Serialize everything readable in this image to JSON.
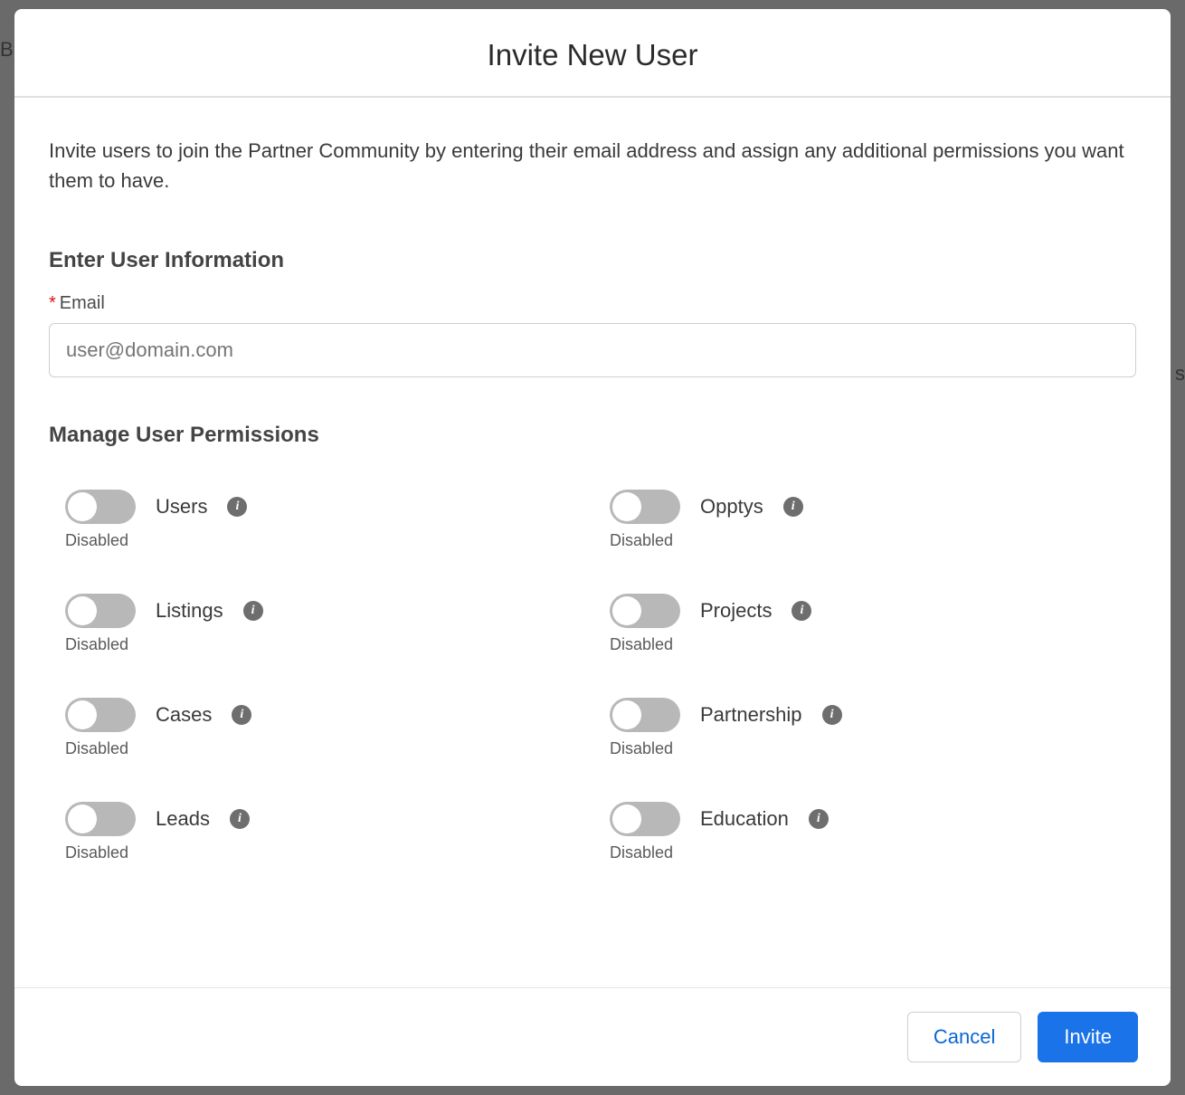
{
  "background": {
    "left_char": "B",
    "right_char": "s"
  },
  "modal": {
    "title": "Invite New User",
    "intro": "Invite users to join the Partner Community by entering their email address and assign any additional permissions you want them to have.",
    "user_info_heading": "Enter User Information",
    "email_label": "Email",
    "email_required": "*",
    "email_placeholder": "user@domain.com",
    "email_value": "",
    "permissions_heading": "Manage User Permissions",
    "permissions": [
      {
        "label": "Users",
        "status": "Disabled"
      },
      {
        "label": "Opptys",
        "status": "Disabled"
      },
      {
        "label": "Listings",
        "status": "Disabled"
      },
      {
        "label": "Projects",
        "status": "Disabled"
      },
      {
        "label": "Cases",
        "status": "Disabled"
      },
      {
        "label": "Partnership",
        "status": "Disabled"
      },
      {
        "label": "Leads",
        "status": "Disabled"
      },
      {
        "label": "Education",
        "status": "Disabled"
      }
    ],
    "info_glyph": "i",
    "footer": {
      "cancel_label": "Cancel",
      "invite_label": "Invite"
    }
  }
}
